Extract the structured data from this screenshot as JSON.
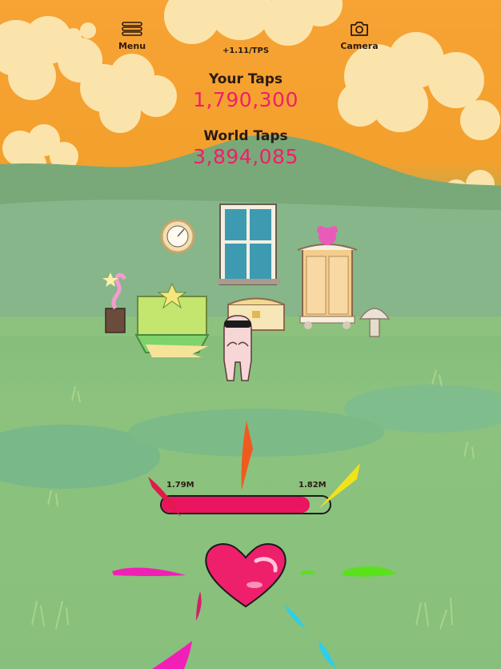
{
  "header": {
    "menu_label": "Menu",
    "menu_icon": "hamburger-icon",
    "camera_label": "Camera",
    "camera_icon": "camera-icon",
    "tps": "+1.11/TPS"
  },
  "counters": {
    "your_label": "Your Taps",
    "your_value": "1,790,300",
    "world_label": "World Taps",
    "world_value": "3,894,085"
  },
  "progress": {
    "start_label": "1.79M",
    "end_label": "1.82M",
    "fraction": 0.88
  },
  "colors": {
    "sky": "#f7a335",
    "grass": "#87c07c",
    "counter_value": "#ee1f6b",
    "heart": "#ee1f6b",
    "progress_fill": "#ea1460"
  }
}
